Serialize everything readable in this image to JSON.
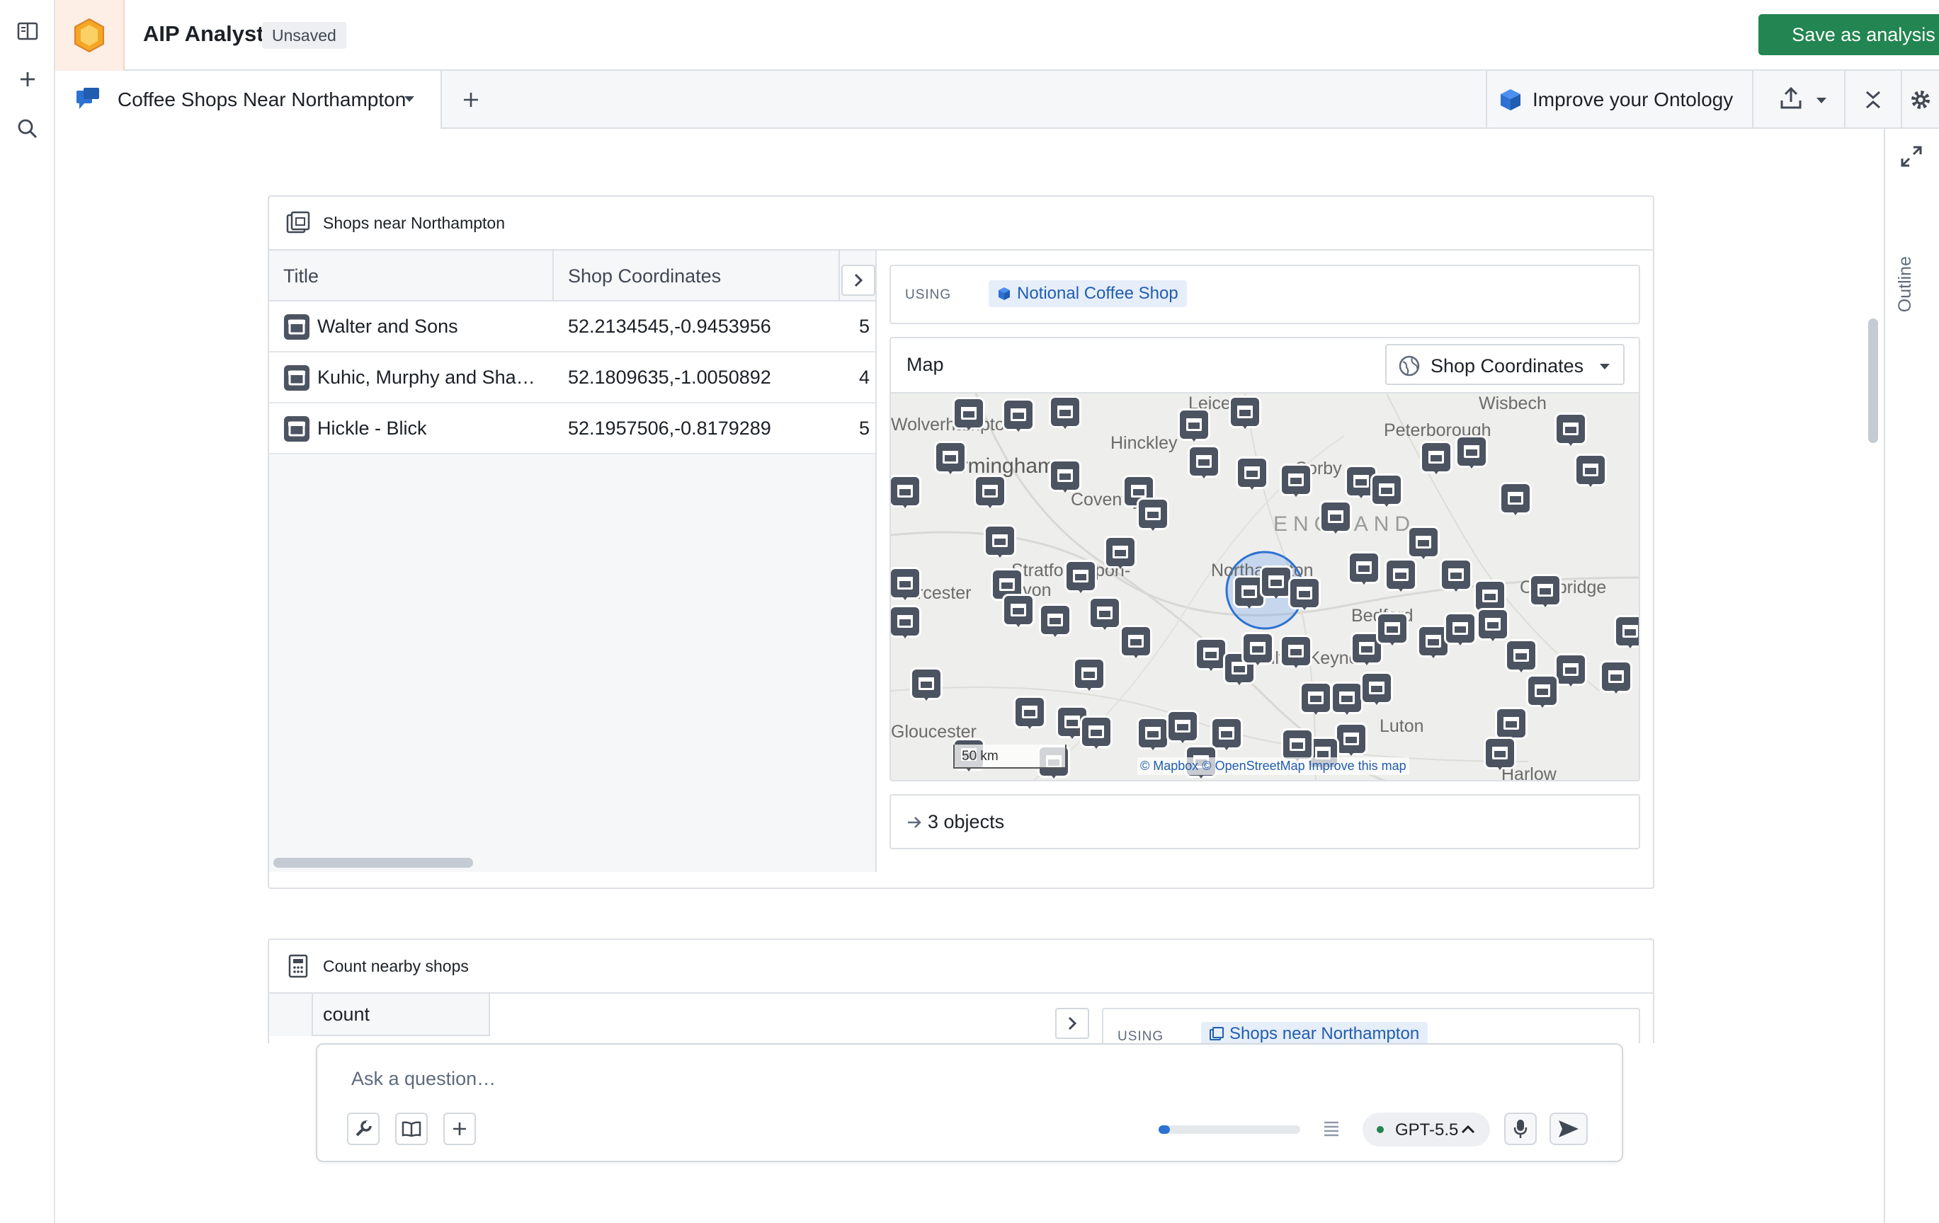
{
  "app": {
    "title": "AIP Analyst",
    "status_badge": "Unsaved",
    "save_label": "Save as analysis"
  },
  "tab": {
    "label": "Coffee Shops Near Northampton"
  },
  "toolbar": {
    "improve_label": "Improve your Ontology"
  },
  "sidebar_right": {
    "outline_label": "Outline"
  },
  "card_shops": {
    "title": "Shops near Northampton",
    "columns": [
      "Title",
      "Shop Coordinates"
    ],
    "rows": [
      {
        "title": "Walter and Sons",
        "coords": "52.2134545,-0.9453956",
        "extra": "5"
      },
      {
        "title": "Kuhic, Murphy and Shanahan",
        "coords": "52.1809635,-1.0050892",
        "extra": "4"
      },
      {
        "title": "Hickle - Blick",
        "coords": "52.1957506,-0.8179289",
        "extra": "5"
      }
    ],
    "using_label": "USING",
    "using_object": "Notional Coffee Shop",
    "map_label": "Map",
    "map_property": "Shop Coordinates",
    "map_places": [
      "Wolverhampton",
      "Birmingham",
      "Hinckley",
      "Leicester",
      "Coventry",
      "Corby",
      "Peterborough",
      "Wisbech",
      "ENGLAND",
      "Stratford-upon-Avon",
      "Worcester",
      "Northampton",
      "Cambridge",
      "Milton Keynes",
      "Bedford",
      "Luton",
      "Gloucester",
      "Harlow"
    ],
    "map_scale": "50 km",
    "map_attribution": "© Mapbox © OpenStreetMap Improve this map",
    "objects_label": "3 objects"
  },
  "card_count": {
    "title": "Count nearby shops",
    "column": "count",
    "using_label": "USING",
    "using_object": "Shops near Northampton"
  },
  "composer": {
    "placeholder": "Ask a question…",
    "model": "GPT-5.5",
    "context_usage_fraction": 0.08
  },
  "colors": {
    "accent": "#2d72d2",
    "save": "#238551",
    "pin": "#4c5361"
  },
  "icons": [
    "panel-icon",
    "plus-icon",
    "search-icon",
    "app-logo-icon",
    "chat-icon",
    "chevron-down-icon",
    "cube-icon",
    "share-icon",
    "collapse-icon",
    "gear-icon",
    "expand-icon",
    "object-set-icon",
    "chevron-right-icon",
    "shop-icon",
    "globe-icon",
    "arrow-right-icon",
    "calculator-icon",
    "wrench-icon",
    "book-icon",
    "list-icon",
    "chevron-up-icon",
    "mic-icon",
    "send-icon"
  ]
}
